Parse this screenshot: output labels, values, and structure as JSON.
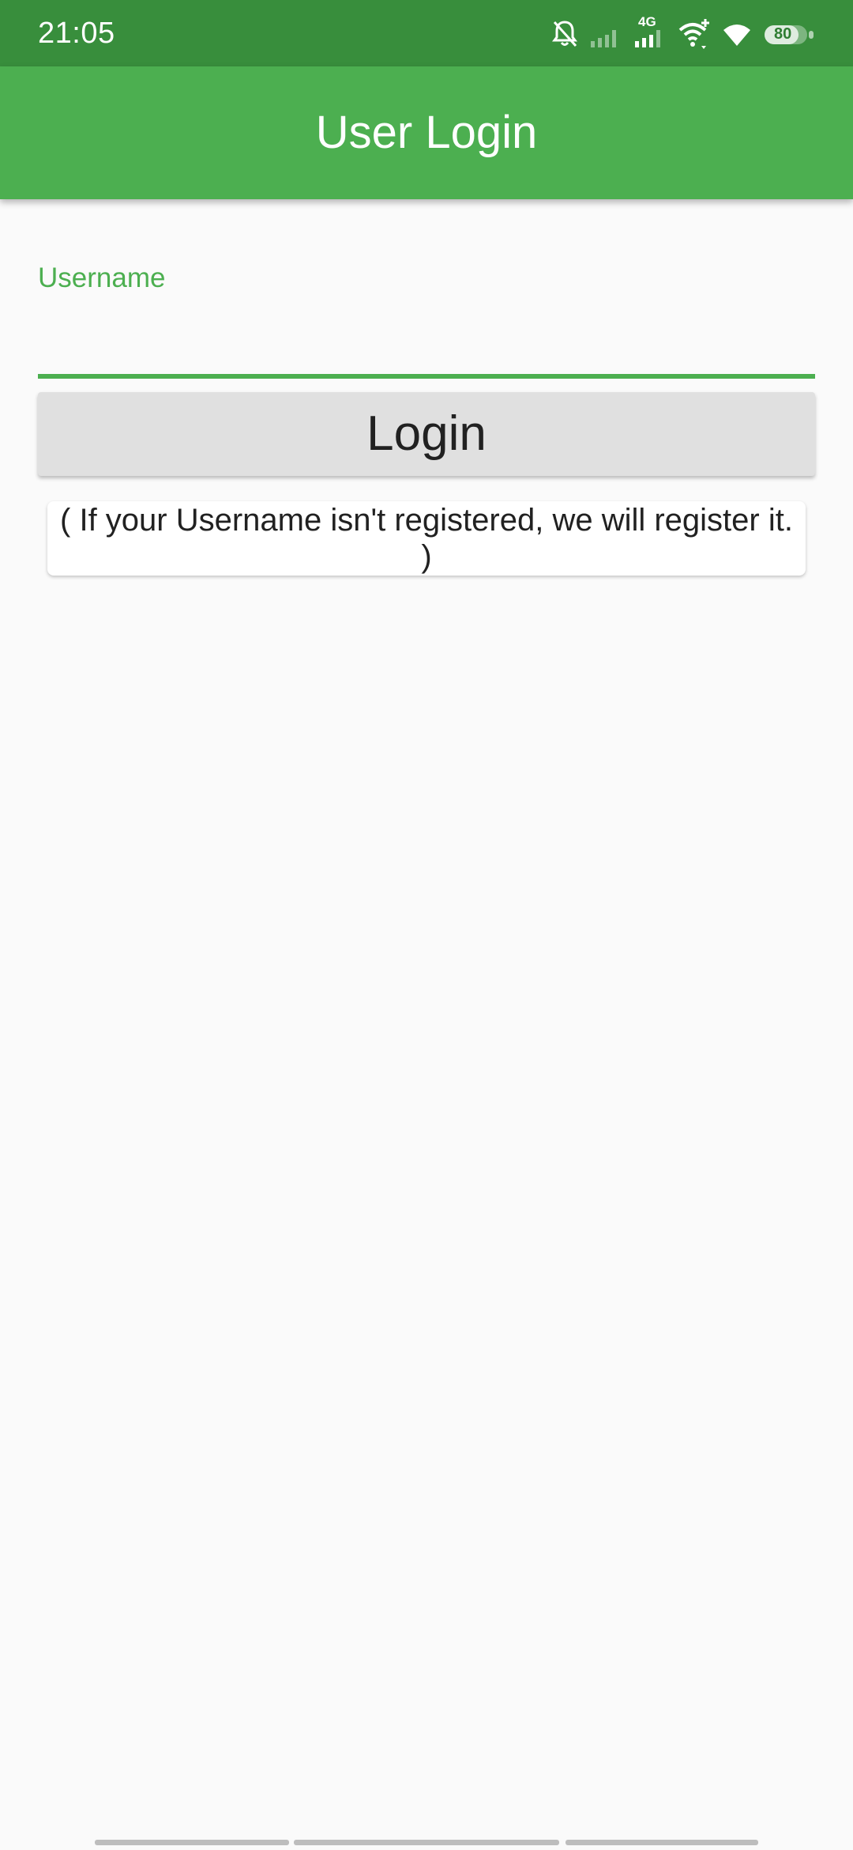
{
  "status_bar": {
    "time": "21:05",
    "network_label": "4G",
    "battery_level": "80",
    "icons": [
      "bell-off-icon",
      "signal-weak-icon",
      "signal-4g-icon",
      "wifi-plus-icon",
      "wifi-icon",
      "battery-icon"
    ]
  },
  "app_bar": {
    "title": "User Login"
  },
  "form": {
    "username_label": "Username",
    "username_value": "",
    "login_label": "Login",
    "hint": "( If your Username isn't registered, we will register it. )"
  },
  "colors": {
    "status_bar": "#388e3c",
    "primary": "#4caf50",
    "button": "#e0e0e0",
    "background": "#fafafa",
    "text": "#212121"
  }
}
